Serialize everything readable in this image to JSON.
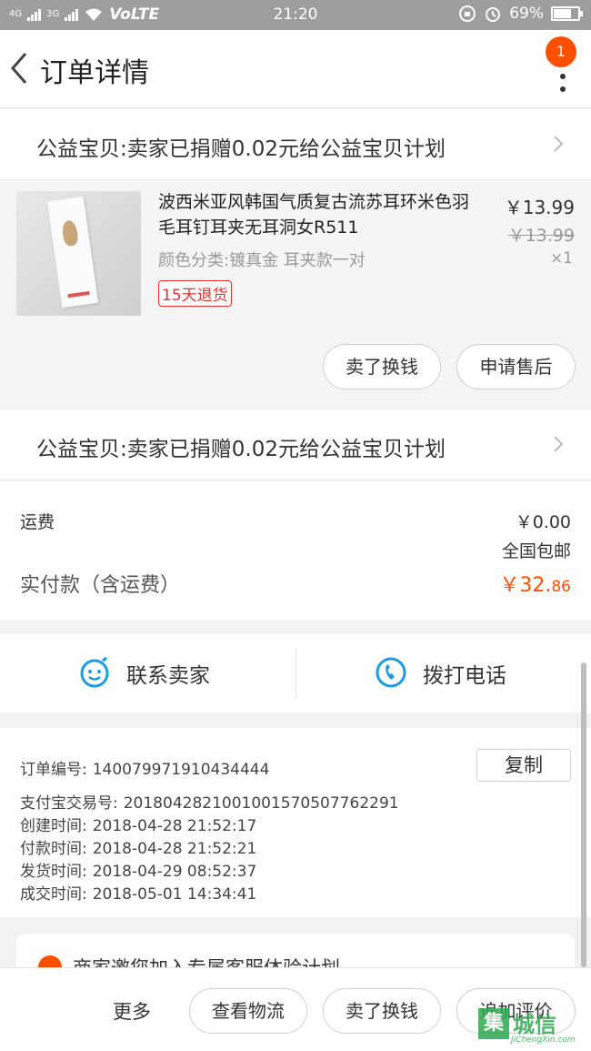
{
  "status_bar": {
    "net1": "4G",
    "net2": "3G",
    "volte": "VoLTE",
    "time": "21:20",
    "battery": "69%",
    "battery_level": 0.69
  },
  "header": {
    "title": "订单详情",
    "badge": "1"
  },
  "charity_1": "公益宝贝:卖家已捐赠0.02元给公益宝贝计划",
  "charity_2": "公益宝贝:卖家已捐赠0.02元给公益宝贝计划",
  "product": {
    "name": "波西米亚风韩国气质复古流苏耳环米色羽毛耳钉耳夹无耳洞女R511",
    "sku": "颜色分类:镀真金 耳夹款一对",
    "return_tag": "15天退货",
    "price": "￥13.99",
    "original_price": "￥13.99",
    "quantity": "×1",
    "actions": [
      "卖了换钱",
      "申请售后"
    ]
  },
  "fees": {
    "shipping_label": "运费",
    "shipping_value": "￥0.00",
    "shipping_note": "全国包邮",
    "total_label": "实付款（含运费）",
    "total_main": "￥32.",
    "total_cents": "86"
  },
  "contact": {
    "seller": "联系卖家",
    "phone": "拨打电话"
  },
  "order_info": {
    "copy_label": "复制",
    "rows": [
      {
        "key": "订单编号:",
        "value": "140079971910434444"
      },
      {
        "key": "支付宝交易号:",
        "value": "2018042821001001570507762291"
      },
      {
        "key": "创建时间:",
        "value": "2018-04-28 21:52:17"
      },
      {
        "key": "付款时间:",
        "value": "2018-04-28 21:52:21"
      },
      {
        "key": "发货时间:",
        "value": "2018-04-29 08:52:37"
      },
      {
        "key": "成交时间:",
        "value": "2018-05-01 14:34:41"
      }
    ]
  },
  "invite": "商家邀您加入专属客服体验计划",
  "bottom_bar": {
    "more": "更多",
    "buttons": [
      "查看物流",
      "卖了换钱",
      "追加评价"
    ]
  },
  "watermark": {
    "cn": "城信",
    "en": "JiChengXin.com"
  },
  "colors": {
    "accent": "#ff5000",
    "return_tag": "#e62e2e",
    "contact_icon": "#1e9be0"
  }
}
